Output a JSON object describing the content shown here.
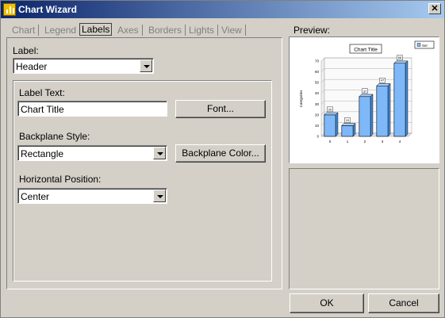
{
  "window": {
    "title": "Chart Wizard",
    "close_glyph": "✕"
  },
  "tabs": [
    {
      "label": "Chart",
      "active": false
    },
    {
      "label": "Legend",
      "active": false
    },
    {
      "label": "Labels",
      "active": true
    },
    {
      "label": "Axes",
      "active": false
    },
    {
      "label": "Borders",
      "active": false
    },
    {
      "label": "Lights",
      "active": false
    },
    {
      "label": "View",
      "active": false
    }
  ],
  "label_section": {
    "label": "Label:",
    "value": "Header"
  },
  "label_text": {
    "label": "Label Text:",
    "value": "Chart Title",
    "font_button": "Font..."
  },
  "backplane": {
    "label": "Backplane Style:",
    "value": "Rectangle",
    "color_button": "Backplane Color..."
  },
  "horizontal_position": {
    "label": "Horizontal Position:",
    "value": "Center"
  },
  "preview": {
    "label": "Preview:"
  },
  "buttons": {
    "ok": "OK",
    "cancel": "Cancel"
  },
  "chart_data": {
    "type": "bar",
    "title": "Chart Title",
    "ylabel": "Categories",
    "xlabel": "",
    "categories": [
      "0",
      "1",
      "2",
      "3",
      "4"
    ],
    "series": [
      {
        "name": "Ser",
        "values": [
          20,
          10,
          37,
          47,
          68
        ]
      }
    ],
    "ylim": [
      0,
      70
    ],
    "yticks": [
      "0",
      "10",
      "20",
      "30",
      "40",
      "50",
      "60",
      "70"
    ],
    "grid": true,
    "legend_position": "top-right",
    "bar_color": "#7eb8f8"
  }
}
